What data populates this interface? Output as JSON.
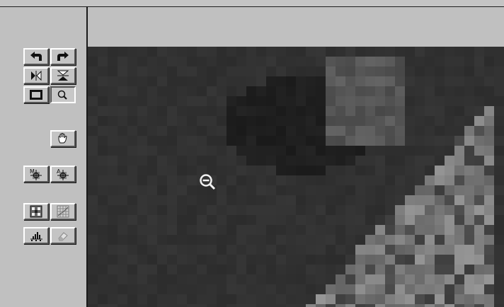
{
  "window": {
    "type": "image-editor-toolbox",
    "background_color": "#c0c0c0",
    "viewport_color": "#2c2c2c"
  },
  "toolbox": {
    "tools": [
      {
        "name": "rotate-left",
        "icon": "rotate-left-icon",
        "pressed": false
      },
      {
        "name": "rotate-right",
        "icon": "rotate-right-icon",
        "pressed": false
      },
      {
        "name": "flip-horizontal",
        "icon": "flip-horizontal-icon",
        "pressed": false
      },
      {
        "name": "flip-vertical",
        "icon": "flip-vertical-icon",
        "pressed": false
      },
      {
        "name": "crop-frame",
        "icon": "frame-icon",
        "pressed": false
      },
      {
        "name": "zoom",
        "icon": "magnifier-icon",
        "pressed": true
      },
      {
        "name": "pan",
        "icon": "hand-icon",
        "pressed": false
      },
      {
        "name": "manual-focus",
        "icon": "manual-target-icon",
        "pressed": false
      },
      {
        "name": "auto-focus",
        "icon": "auto-target-icon",
        "pressed": false
      },
      {
        "name": "auto-exposure",
        "icon": "exposure-grid-icon",
        "pressed": false
      },
      {
        "name": "color-balance",
        "icon": "balance-grid-icon",
        "pressed": false
      },
      {
        "name": "histogram",
        "icon": "histogram-icon",
        "pressed": false
      },
      {
        "name": "undo-adjustment",
        "icon": "eraser-icon",
        "pressed": false
      }
    ],
    "button_labels": {
      "manual": "M",
      "auto": "A"
    }
  },
  "cursor": {
    "icon": "zoom-out-cursor-icon",
    "mode": "zoom-out"
  }
}
